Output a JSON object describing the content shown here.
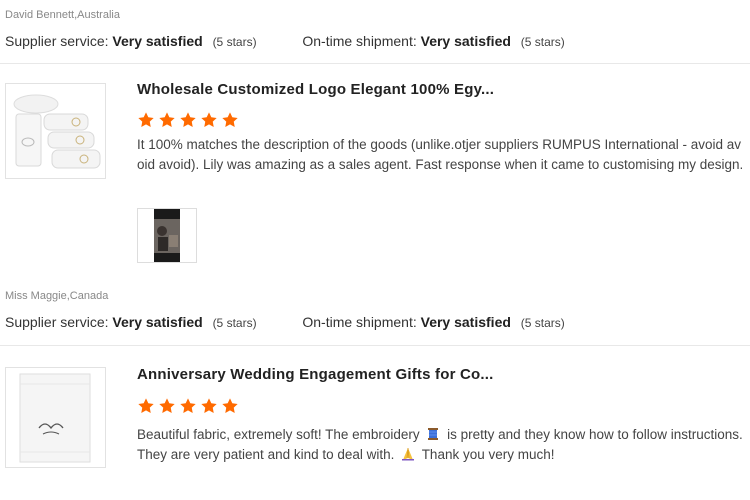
{
  "review1": {
    "reviewer": "David Bennett,Australia",
    "supplier_label": "Supplier service:",
    "supplier_value": "Very satisfied",
    "supplier_stars": "(5 stars)",
    "shipment_label": "On-time shipment:",
    "shipment_value": "Very satisfied",
    "shipment_stars": "(5 stars)"
  },
  "product1": {
    "title": "Wholesale Customized Logo Elegant 100% Egy...",
    "rating": 5,
    "review_text": "It 100% matches the description of the goods (unlike.otjer suppliers RUMPUS International - avoid avoid avoid). Lily was amazing as a sales agent. Fast response when it came to customising my design.",
    "image_icon": "folded-white-towels-thumbnail",
    "video_icon": "review-video-thumbnail"
  },
  "review2": {
    "reviewer": "Miss Maggie,Canada",
    "supplier_label": "Supplier service:",
    "supplier_value": "Very satisfied",
    "supplier_stars": "(5 stars)",
    "shipment_label": "On-time shipment:",
    "shipment_value": "Very satisfied",
    "shipment_stars": "(5 stars)"
  },
  "product2": {
    "title": "Anniversary Wedding Engagement Gifts for Co...",
    "rating": 5,
    "review_text_a": "Beautiful fabric, extremely soft! The embroidery",
    "review_text_b": "is pretty and they know how to follow instructions. They are very patient and kind to deal with.",
    "review_text_c": "Thank you very much!",
    "image_icon": "embroidered-towel-thumbnail",
    "emoji_1": "spool-of-thread-icon",
    "emoji_2": "folded-hands-icon"
  },
  "colors": {
    "star": "#ff6a00",
    "text": "#333333",
    "muted": "#888888"
  }
}
